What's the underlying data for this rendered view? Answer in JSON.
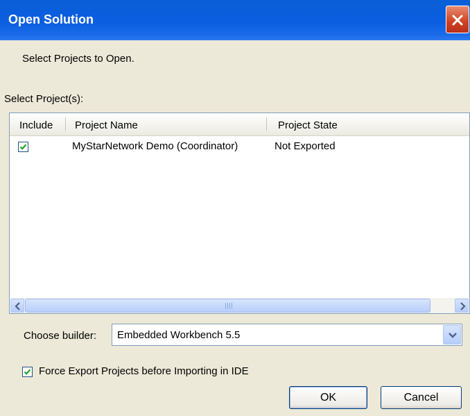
{
  "window": {
    "title": "Open Solution"
  },
  "instruction": "Select Projects to Open.",
  "select_label": "Select Project(s):",
  "table": {
    "columns": [
      "Include",
      "Project Name",
      "Project State"
    ],
    "rows": [
      {
        "include": true,
        "name": "MyStarNetwork Demo (Coordinator)",
        "state": "Not Exported"
      }
    ]
  },
  "builder": {
    "label": "Choose builder:",
    "value": "Embedded Workbench 5.5"
  },
  "force_export": {
    "checked": true,
    "label": "Force Export Projects before Importing in IDE"
  },
  "buttons": {
    "ok": "OK",
    "cancel": "Cancel"
  },
  "colors": {
    "titlebar": "#0b5ee0",
    "close": "#cf4022",
    "face": "#ece9d8",
    "check": "#21a121"
  }
}
